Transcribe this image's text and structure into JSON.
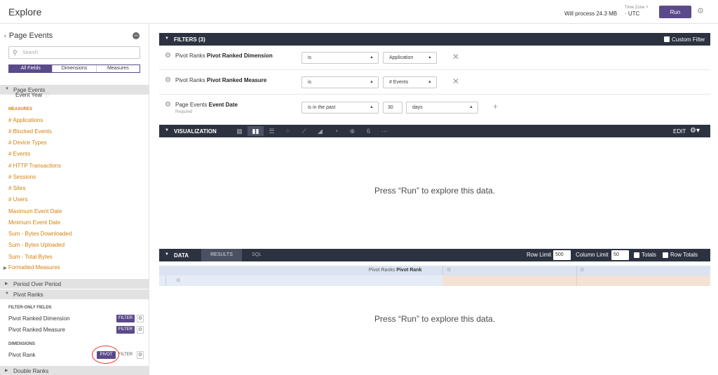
{
  "header": {
    "title": "Explore",
    "process_text": "Will process 24.3 MB",
    "timezone_label": "Time Zone ˅",
    "timezone_value": "· UTC",
    "run_label": "Run"
  },
  "sidebar": {
    "view_title": "Page Events",
    "search_placeholder": "Search",
    "tabs": [
      "All Fields",
      "Dimensions",
      "Measures"
    ],
    "page_events_section": "Page Events",
    "event_year": "Event Year",
    "measures_caption": "MEASURES",
    "measures": [
      "# Applications",
      "# Blocked Events",
      "# Device Types",
      "# Events",
      "# HTTP Transactions",
      "# Sessions",
      "# Sites",
      "# Users",
      "Maximum Event Date",
      "Minimum Event Date",
      "Sum - Bytes Downloaded",
      "Sum - Bytes Uploaded",
      "Sum - Total Bytes",
      "Formatted Measures"
    ],
    "period_section": "Period Over Period",
    "pivot_ranks_section": "Pivot Ranks",
    "filter_only_caption": "FILTER-ONLY FIELDS",
    "filter_only_fields": [
      "Pivot Ranked Dimension",
      "Pivot Ranked Measure"
    ],
    "dimensions_caption": "DIMENSIONS",
    "dimension_field": "Pivot Rank",
    "filter_btn": "FILTER",
    "pivot_btn": "PIVOT",
    "double_ranks_section": "Double Ranks"
  },
  "filters": {
    "bar_label": "FILTERS (3)",
    "custom_filter_label": "Custom Filter",
    "rows": [
      {
        "view": "Pivot Ranks",
        "field": "Pivot Ranked Dimension",
        "op": "is",
        "value": "Application"
      },
      {
        "view": "Pivot Ranks",
        "field": "Pivot Ranked Measure",
        "op": "is",
        "value": "# Events"
      },
      {
        "view": "Page Events",
        "field": "Event Date",
        "required": "Required",
        "op": "is in the past",
        "number": "30",
        "unit": "days"
      }
    ]
  },
  "visualization": {
    "bar_label": "VISUALIZATION",
    "edit_label": "EDIT",
    "empty_message": "Press “Run” to explore this data."
  },
  "data_panel": {
    "bar_label": "DATA",
    "tab_results": "RESULTS",
    "tab_sql": "SQL",
    "row_limit_label": "Row Limit",
    "row_limit_value": "500",
    "column_limit_label": "Column Limit",
    "column_limit_value": "50",
    "totals_label": "Totals",
    "row_totals_label": "Row Totals",
    "pivot_header_view": "Pivot Ranks",
    "pivot_header_field": "Pivot Rank",
    "empty_message": "Press “Run” to explore this data."
  }
}
